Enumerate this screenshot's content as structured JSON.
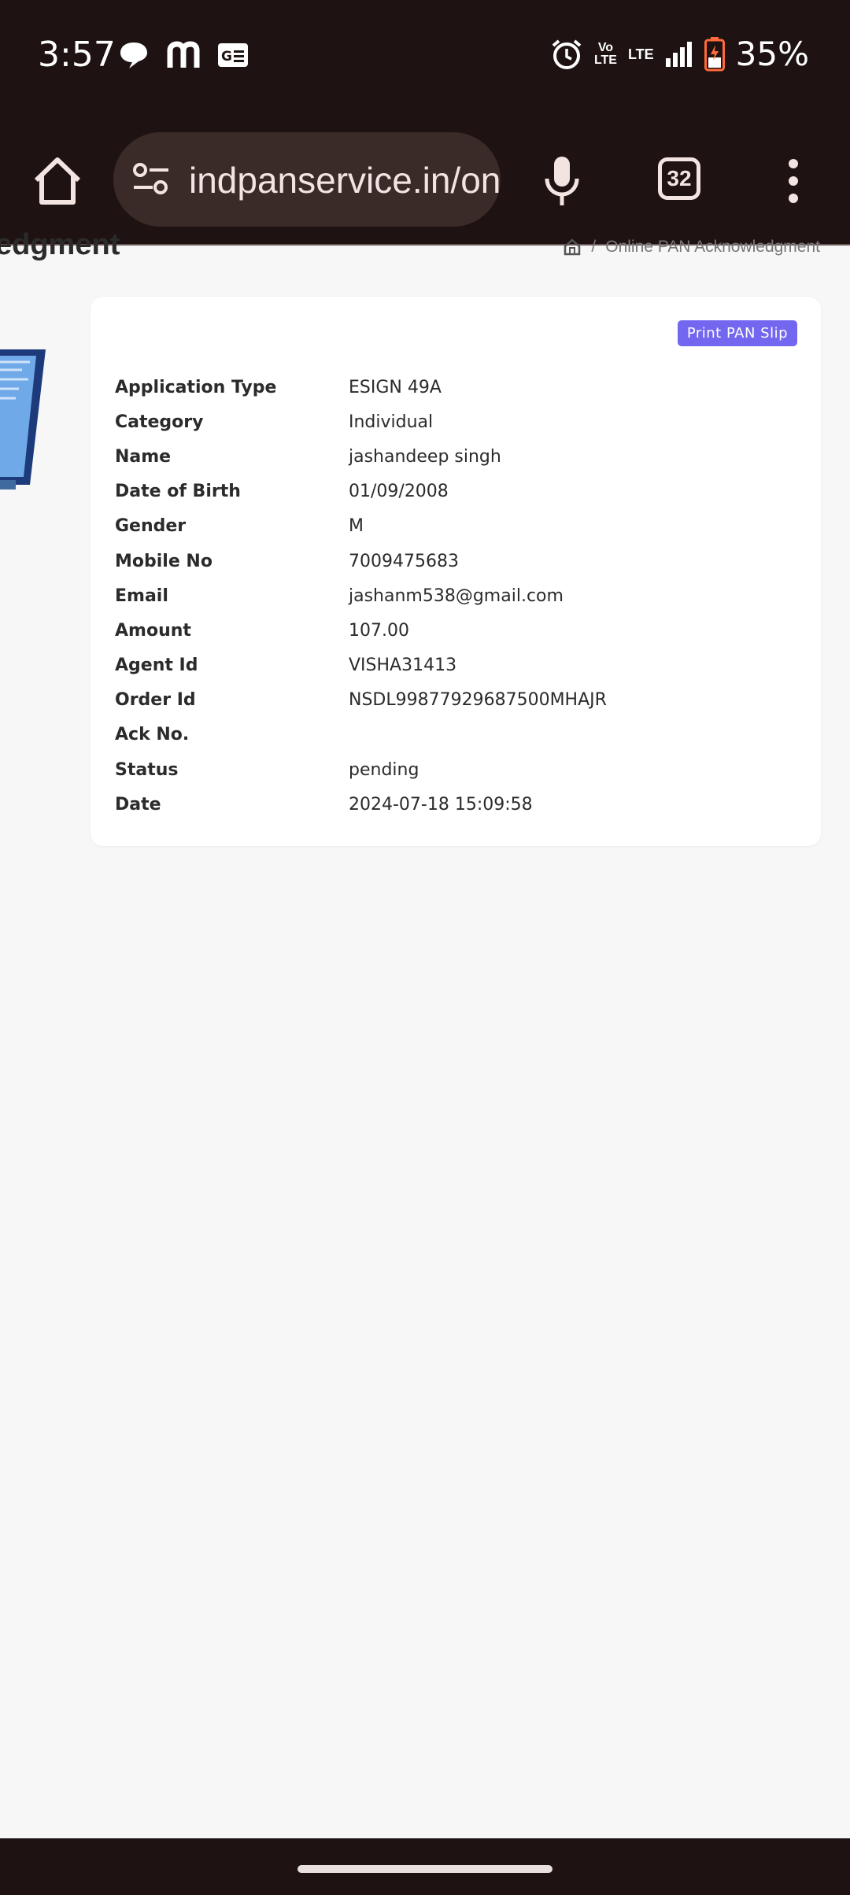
{
  "status_bar": {
    "time": "3:57",
    "left_icons": [
      "chat-bubble-icon",
      "m-app-icon",
      "news-icon"
    ],
    "right_icons": [
      "alarm-icon",
      "volte-icon",
      "lte-icon",
      "signal-icon",
      "battery-icon"
    ],
    "volte_label_top": "Vo",
    "volte_label_bottom": "LTE",
    "lte_label": "LTE",
    "battery_percent": "35%"
  },
  "browser": {
    "url": "indpanservice.in/online-pan-acknowledgment",
    "tab_count": "32"
  },
  "page": {
    "heading": "edgment",
    "breadcrumb_current": "Online PAN Acknowledgment",
    "breadcrumb_separator": "/"
  },
  "card": {
    "print_button_label": "Print PAN Slip",
    "fields": [
      {
        "label": "Application Type",
        "value": "ESIGN 49A"
      },
      {
        "label": "Category",
        "value": "Individual"
      },
      {
        "label": "Name",
        "value": "jashandeep singh"
      },
      {
        "label": "Date of Birth",
        "value": "01/09/2008"
      },
      {
        "label": "Gender",
        "value": "M"
      },
      {
        "label": "Mobile No",
        "value": "7009475683"
      },
      {
        "label": "Email",
        "value": "jashanm538@gmail.com"
      },
      {
        "label": "Amount",
        "value": "107.00"
      },
      {
        "label": "Agent Id",
        "value": "VISHA31413"
      },
      {
        "label": "Order Id",
        "value": "NSDL99877929687500MHAJR"
      },
      {
        "label": "Ack No.",
        "value": ""
      },
      {
        "label": "Status",
        "value": "pending"
      },
      {
        "label": "Date",
        "value": "2024-07-18 15:09:58"
      }
    ]
  },
  "colors": {
    "status_bar_bg": "#1e1212",
    "print_button": "#7367f0",
    "page_bg": "#f7f7f7"
  }
}
